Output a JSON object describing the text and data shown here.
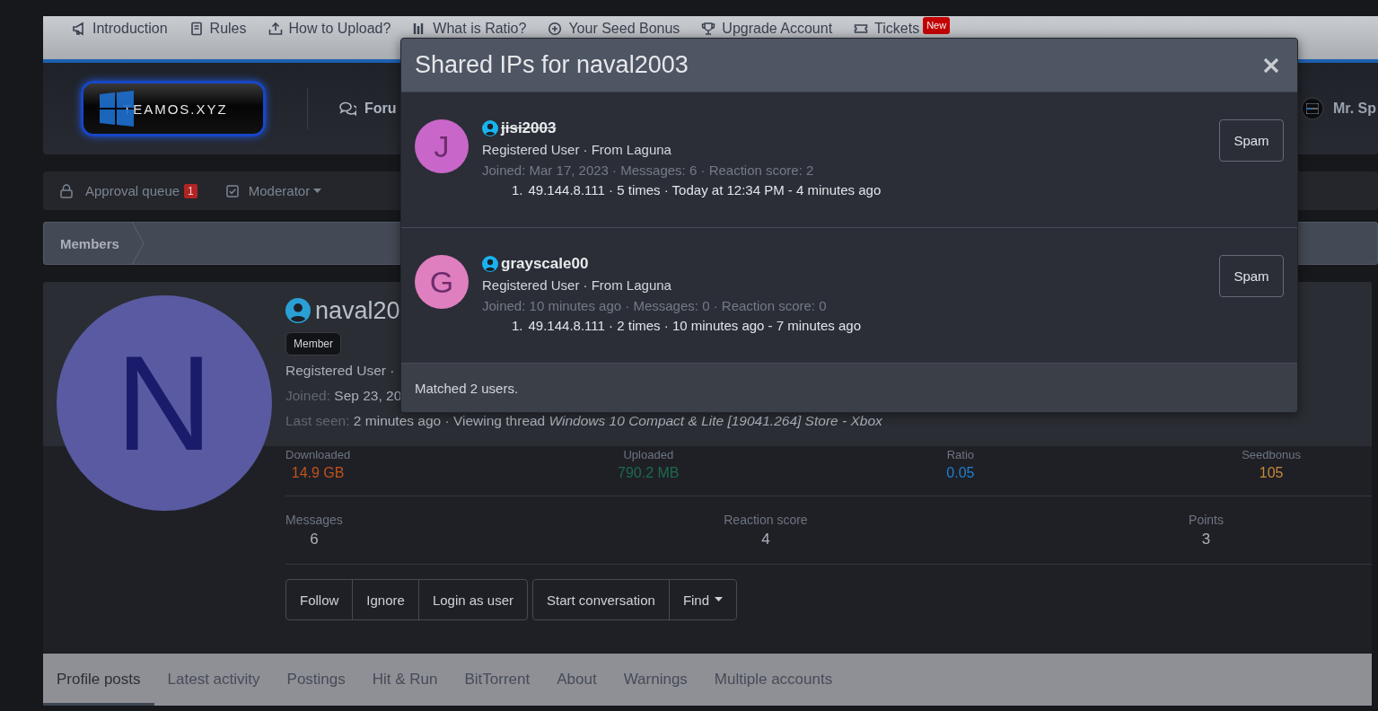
{
  "top_nav": {
    "items": [
      {
        "label": "Introduction"
      },
      {
        "label": "Rules"
      },
      {
        "label": "How to Upload?"
      },
      {
        "label": "What is Ratio?"
      },
      {
        "label": "Your Seed Bonus"
      },
      {
        "label": "Upgrade Account"
      },
      {
        "label": "Tickets",
        "badge": "New"
      }
    ]
  },
  "header": {
    "logo_text": "TEAMOS.XYZ",
    "nav_item": "Foru",
    "user_name": "Mr. Sp"
  },
  "moderator_bar": {
    "items": [
      {
        "kind": "queue",
        "label": "Approval queue",
        "badge": "1"
      },
      {
        "kind": "menu",
        "label": "Moderator"
      }
    ]
  },
  "breadcrumb": [
    "Members"
  ],
  "profile": {
    "avatar_letter": "N",
    "name": "naval20",
    "banner": "Member",
    "title_line": "Registered User ·",
    "joined_label": "Joined:",
    "joined_value": "Sep 23, 20",
    "last_seen_label": "Last seen:",
    "last_seen_value": "2 minutes ago · Viewing thread *Windows 10 Compact & Lite [19041.264] Store - Xbox*",
    "stats": [
      {
        "label": "Downloaded",
        "value": "14.9 GB",
        "color": "#c0521a"
      },
      {
        "label": "Uploaded",
        "value": "790.2 MB",
        "color": "#1d6a4c"
      },
      {
        "label": "Ratio",
        "value": "0.05",
        "color": "#1f7fd0"
      },
      {
        "label": "Seedbonus",
        "value": "105",
        "color": "#c88838"
      }
    ],
    "counts": [
      {
        "label": "Messages",
        "value": "6"
      },
      {
        "label": "Reaction score",
        "value": "4"
      },
      {
        "label": "Points",
        "value": "3"
      }
    ],
    "button_groups": [
      [
        {
          "label": "Follow",
          "kind": "plain"
        },
        {
          "label": "Ignore",
          "kind": "plain"
        },
        {
          "label": "Login as user",
          "kind": "plain"
        }
      ],
      [
        {
          "label": "Start conversation",
          "kind": "plain"
        },
        {
          "label": "Find",
          "kind": "menu"
        }
      ]
    ]
  },
  "tabs": [
    {
      "label": "Profile posts",
      "selected": true
    },
    {
      "label": "Latest activity",
      "selected": false
    },
    {
      "label": "Postings",
      "selected": false
    },
    {
      "label": "Hit & Run",
      "selected": false
    },
    {
      "label": "BitTorrent",
      "selected": false
    },
    {
      "label": "About",
      "selected": false
    },
    {
      "label": "Warnings",
      "selected": false
    },
    {
      "label": "Multiple accounts",
      "selected": false
    }
  ],
  "modal": {
    "title": "Shared IPs for naval2003",
    "users": [
      {
        "avatar_letter": "J",
        "color": "#c966c9",
        "name": "jisi2003",
        "banned": true,
        "title_line": "Registered User · From Laguna",
        "stats_line": "Joined: Mar 17, 2023 · Messages: 6 · Reaction score: 2",
        "ips": [
          {
            "number": "1.",
            "text": "49.144.8.111 · 5 times · Today at 12:34 PM - 4 minutes ago"
          }
        ],
        "button": "Spam"
      },
      {
        "avatar_letter": "G",
        "color": "#e07fbf",
        "name": "grayscale00",
        "banned": false,
        "title_line": "Registered User · From Laguna",
        "stats_line": "Joined: 10 minutes ago · Messages: 0 · Reaction score: 0",
        "ips": [
          {
            "number": "1.",
            "text": "49.144.8.111 · 2 times · 10 minutes ago - 7 minutes ago"
          }
        ],
        "button": "Spam"
      }
    ],
    "footer": "Matched 2 users."
  }
}
